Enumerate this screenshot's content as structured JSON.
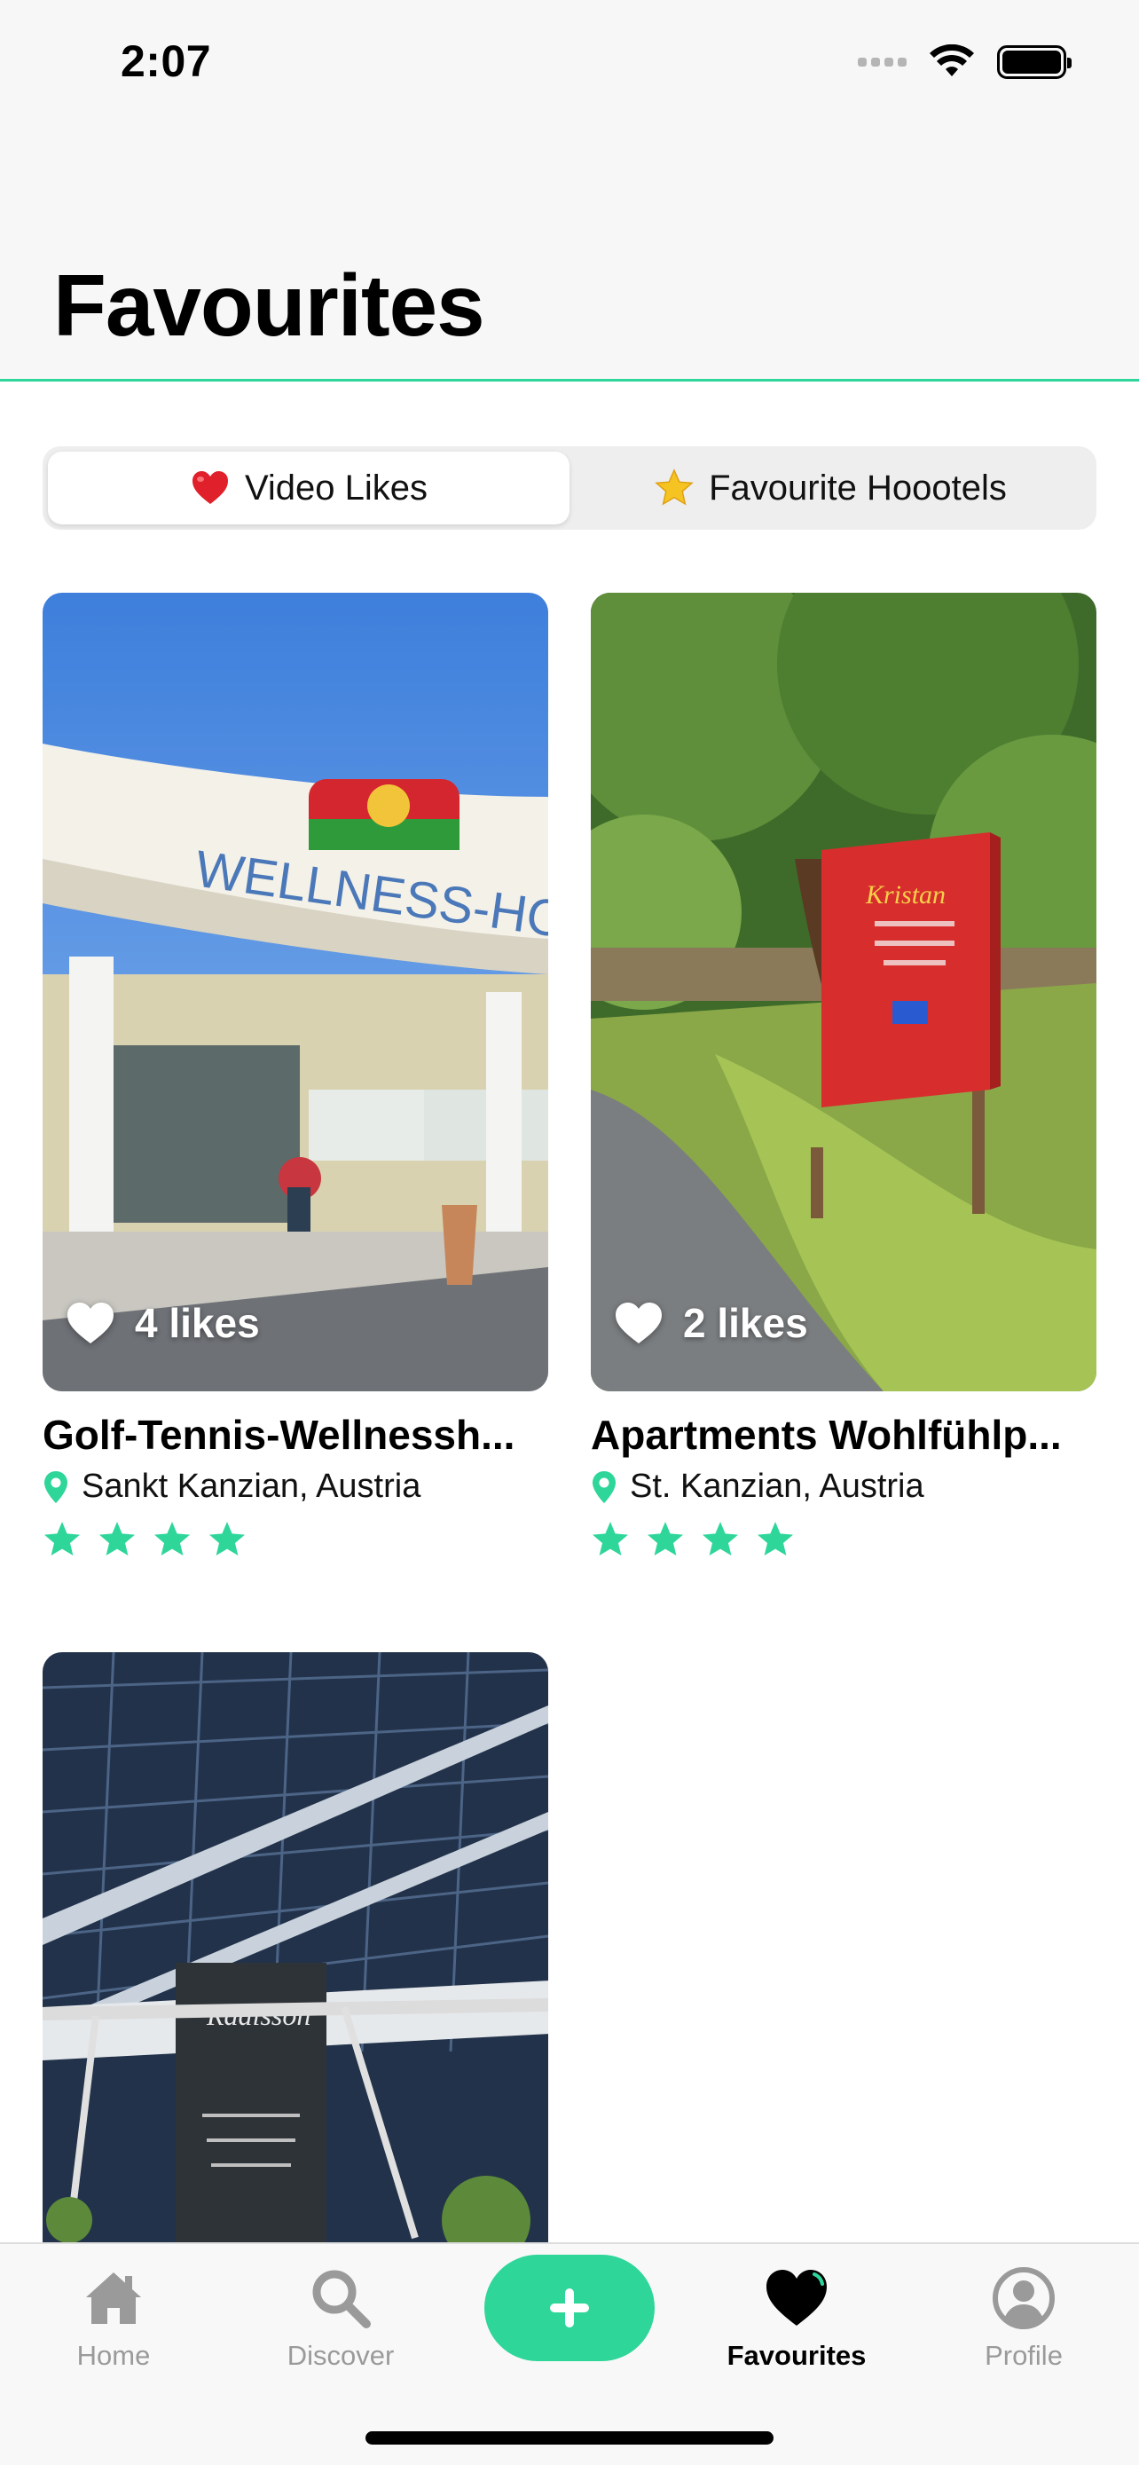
{
  "status_bar": {
    "time": "2:07"
  },
  "header": {
    "title": "Favourites"
  },
  "segments": [
    {
      "label": "Video Likes",
      "icon": "heart-emoji-icon",
      "active": true
    },
    {
      "label": "Favourite Hoootels",
      "icon": "star-emoji-icon",
      "active": false
    }
  ],
  "cards": [
    {
      "title": "Golf-Tennis-Wellnessh...",
      "location": "Sankt Kanzian, Austria",
      "likes": "4 likes",
      "stars": 4
    },
    {
      "title": "Apartments Wohlfühlp...",
      "location": "St. Kanzian, Austria",
      "likes": "2 likes",
      "stars": 4
    },
    {
      "title": "",
      "location": "",
      "likes": "",
      "stars": 0
    }
  ],
  "tabbar": {
    "items": [
      {
        "label": "Home",
        "icon": "house-icon",
        "active": false
      },
      {
        "label": "Discover",
        "icon": "magnifier-icon",
        "active": false
      },
      {
        "label": "",
        "icon": "plus-icon",
        "active": false
      },
      {
        "label": "Favourites",
        "icon": "heart-icon",
        "active": true
      },
      {
        "label": "Profile",
        "icon": "person-circle-icon",
        "active": false
      }
    ]
  },
  "colors": {
    "accent": "#2ed69a",
    "inactive": "#9a9a9a",
    "heart_red": "#e0202a",
    "star_yellow": "#f5c422"
  }
}
